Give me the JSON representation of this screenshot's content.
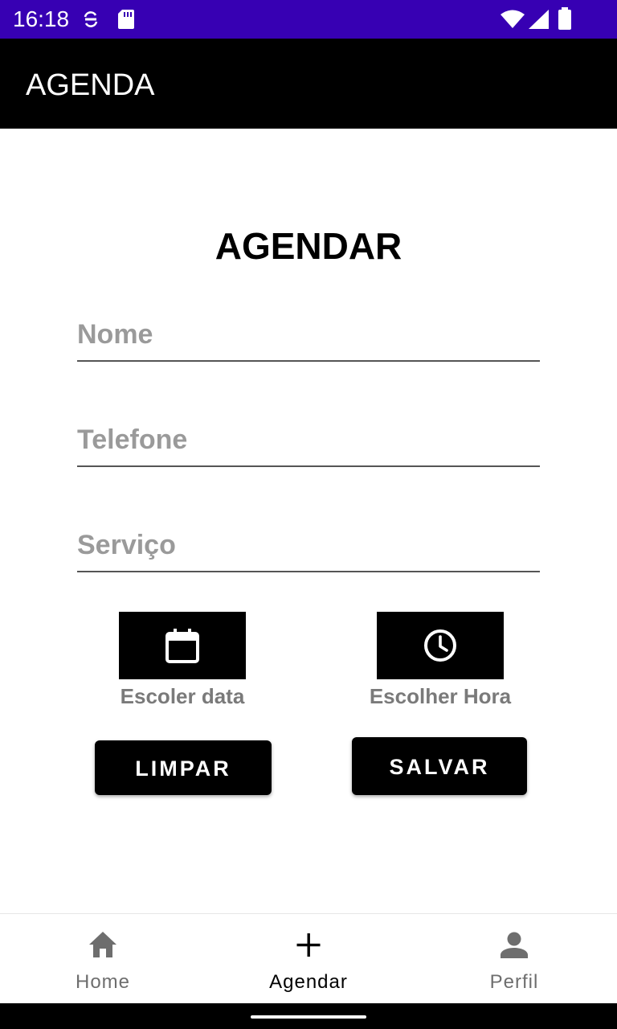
{
  "status_bar": {
    "time": "16:18",
    "background": "#3700B3",
    "left_icons": [
      "sync-icon",
      "sd-card-icon"
    ],
    "right_icons": [
      "wifi-icon",
      "cell-signal-icon",
      "battery-icon"
    ]
  },
  "app_bar": {
    "title": "AGENDA",
    "background": "#000000"
  },
  "form": {
    "title": "AGENDAR",
    "fields": [
      {
        "name": "nome",
        "placeholder": "Nome",
        "value": ""
      },
      {
        "name": "telefone",
        "placeholder": "Telefone",
        "value": ""
      },
      {
        "name": "servico",
        "placeholder": "Serviço",
        "value": ""
      }
    ],
    "date_picker": {
      "icon": "calendar-icon",
      "label": "Escoler data"
    },
    "time_picker": {
      "icon": "clock-icon",
      "label": "Escolher Hora"
    },
    "clear_button": "LIMPAR",
    "save_button": "SALVAR"
  },
  "bottom_nav": {
    "items": [
      {
        "label": "Home",
        "icon": "home-icon",
        "active": false
      },
      {
        "label": "Agendar",
        "icon": "plus-icon",
        "active": true
      },
      {
        "label": "Perfil",
        "icon": "person-icon",
        "active": false
      }
    ]
  },
  "colors": {
    "accent": "#000000",
    "status_bar": "#3700B3",
    "placeholder": "#9a9a9a",
    "inactive_nav": "#6e6e6e"
  }
}
